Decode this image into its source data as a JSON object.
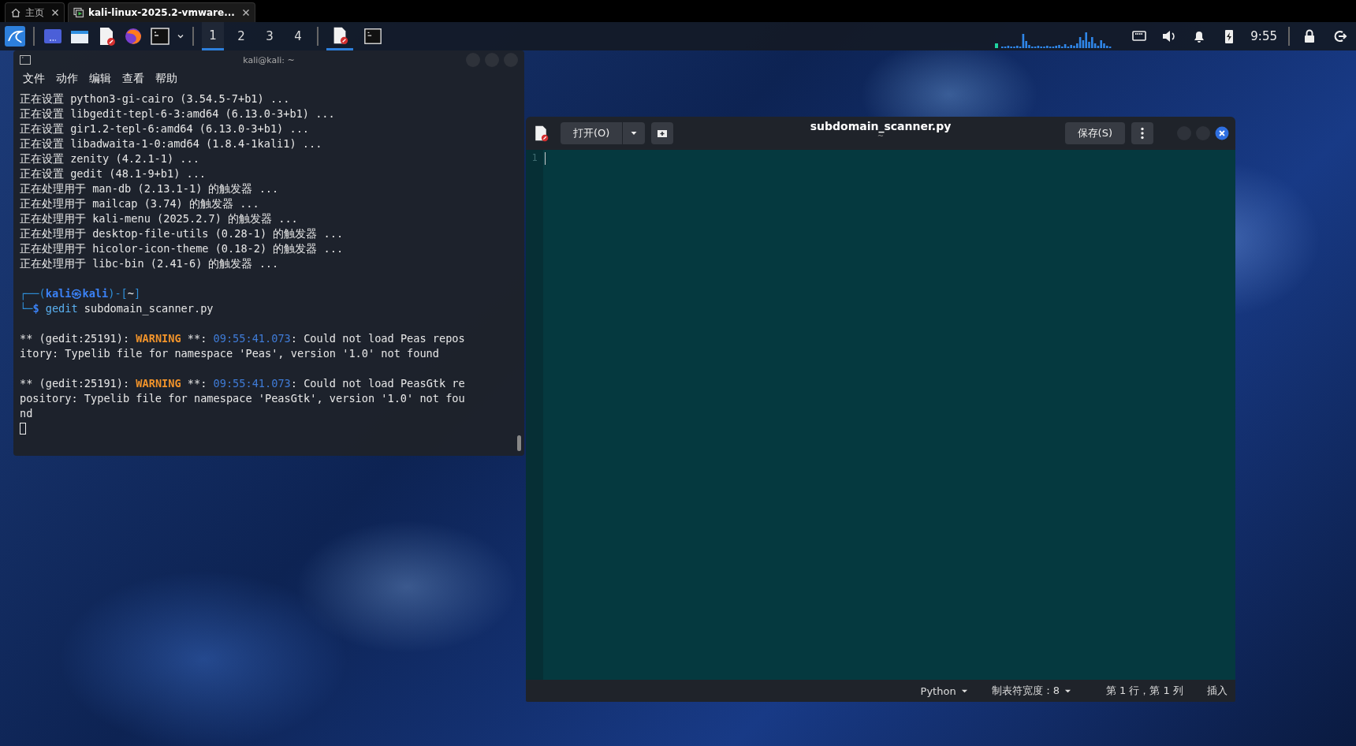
{
  "browser_tabs": [
    {
      "label": "主页",
      "selected": false
    },
    {
      "label": "kali-linux-2025.2-vmware...",
      "selected": true
    }
  ],
  "taskbar": {
    "workspaces": [
      {
        "label": "1",
        "selected": true
      },
      {
        "label": "2",
        "selected": false
      },
      {
        "label": "3",
        "selected": false
      },
      {
        "label": "4",
        "selected": false
      }
    ],
    "windows": [
      {
        "kind": "editor",
        "selected": true
      },
      {
        "kind": "terminal",
        "selected": false
      }
    ],
    "clock": "9:55"
  },
  "terminal": {
    "title": "kali@kali: ~",
    "menu": [
      "文件",
      "动作",
      "编辑",
      "查看",
      "帮助"
    ],
    "lines": [
      {
        "kind": "text",
        "segments": [
          {
            "kind": "plain",
            "text": "正在设置 python3-gi-cairo (3.54.5-7+b1) ..."
          }
        ]
      },
      {
        "kind": "text",
        "segments": [
          {
            "kind": "plain",
            "text": "正在设置 libgedit-tepl-6-3:amd64 (6.13.0-3+b1) ..."
          }
        ]
      },
      {
        "kind": "text",
        "segments": [
          {
            "kind": "plain",
            "text": "正在设置 gir1.2-tepl-6:amd64 (6.13.0-3+b1) ..."
          }
        ]
      },
      {
        "kind": "text",
        "segments": [
          {
            "kind": "plain",
            "text": "正在设置 libadwaita-1-0:amd64 (1.8.4-1kali1) ..."
          }
        ]
      },
      {
        "kind": "text",
        "segments": [
          {
            "kind": "plain",
            "text": "正在设置 zenity (4.2.1-1) ..."
          }
        ]
      },
      {
        "kind": "text",
        "segments": [
          {
            "kind": "plain",
            "text": "正在设置 gedit (48.1-9+b1) ..."
          }
        ]
      },
      {
        "kind": "text",
        "segments": [
          {
            "kind": "plain",
            "text": "正在处理用于 man-db (2.13.1-1) 的触发器 ..."
          }
        ]
      },
      {
        "kind": "text",
        "segments": [
          {
            "kind": "plain",
            "text": "正在处理用于 mailcap (3.74) 的触发器 ..."
          }
        ]
      },
      {
        "kind": "text",
        "segments": [
          {
            "kind": "plain",
            "text": "正在处理用于 kali-menu (2025.2.7) 的触发器 ..."
          }
        ]
      },
      {
        "kind": "text",
        "segments": [
          {
            "kind": "plain",
            "text": "正在处理用于 desktop-file-utils (0.28-1) 的触发器 ..."
          }
        ]
      },
      {
        "kind": "text",
        "segments": [
          {
            "kind": "plain",
            "text": "正在处理用于 hicolor-icon-theme (0.18-2) 的触发器 ..."
          }
        ]
      },
      {
        "kind": "text",
        "segments": [
          {
            "kind": "plain",
            "text": "正在处理用于 libc-bin (2.41-6) 的触发器 ..."
          }
        ]
      },
      {
        "kind": "blank"
      },
      {
        "kind": "text",
        "segments": [
          {
            "kind": "frame",
            "text": "┌──("
          },
          {
            "kind": "user",
            "text": "kali㉿kali"
          },
          {
            "kind": "frame",
            "text": ")-["
          },
          {
            "kind": "plain",
            "text": "~"
          },
          {
            "kind": "frame",
            "text": "]"
          }
        ]
      },
      {
        "kind": "text",
        "segments": [
          {
            "kind": "frame",
            "text": "└─"
          },
          {
            "kind": "user",
            "text": "$ "
          },
          {
            "kind": "cmd",
            "text": "gedit"
          },
          {
            "kind": "plain",
            "text": " subdomain_scanner.py"
          }
        ]
      },
      {
        "kind": "blank"
      },
      {
        "kind": "text",
        "segments": [
          {
            "kind": "plain",
            "text": "** (gedit:25191): "
          },
          {
            "kind": "warn",
            "text": "WARNING"
          },
          {
            "kind": "plain",
            "text": " **: "
          },
          {
            "kind": "time",
            "text": "09:55:41.073"
          },
          {
            "kind": "plain",
            "text": ": Could not load Peas repos"
          }
        ]
      },
      {
        "kind": "text",
        "segments": [
          {
            "kind": "plain",
            "text": "itory: Typelib file for namespace 'Peas', version '1.0' not found"
          }
        ]
      },
      {
        "kind": "blank"
      },
      {
        "kind": "text",
        "segments": [
          {
            "kind": "plain",
            "text": "** (gedit:25191): "
          },
          {
            "kind": "warn",
            "text": "WARNING"
          },
          {
            "kind": "plain",
            "text": " **: "
          },
          {
            "kind": "time",
            "text": "09:55:41.073"
          },
          {
            "kind": "plain",
            "text": ": Could not load PeasGtk re"
          }
        ]
      },
      {
        "kind": "text",
        "segments": [
          {
            "kind": "plain",
            "text": "pository: Typelib file for namespace 'PeasGtk', version '1.0' not fou"
          }
        ]
      },
      {
        "kind": "text",
        "segments": [
          {
            "kind": "plain",
            "text": "nd"
          }
        ]
      }
    ]
  },
  "editor": {
    "open_button": "打开(O)",
    "title": "subdomain_scanner.py",
    "subtitle": "~",
    "save_button": "保存(S)",
    "line_numbers": [
      "1"
    ],
    "status_bar": {
      "language": "Python",
      "tab_width": "制表符宽度：8",
      "position": "第 1 行，第 1 列",
      "mode": "插入"
    }
  }
}
